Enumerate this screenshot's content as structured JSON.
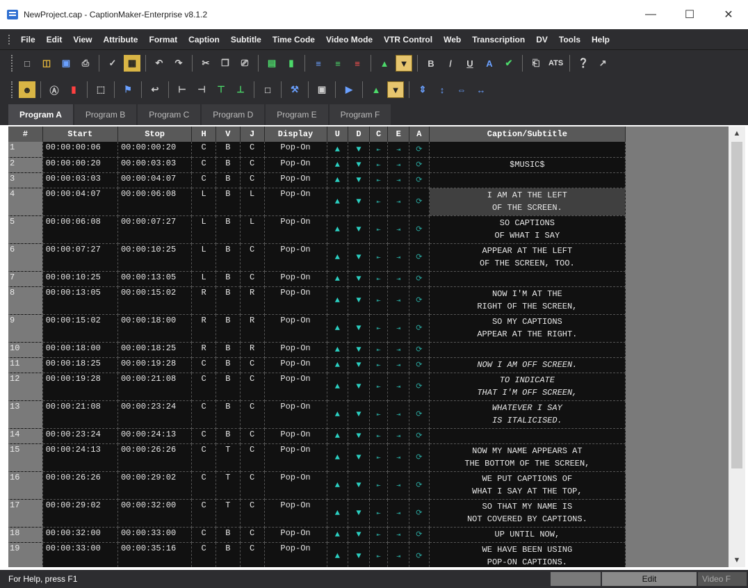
{
  "window": {
    "title": "NewProject.cap - CaptionMaker-Enterprise v8.1.2",
    "minimize": "—",
    "maximize": "☐",
    "close": "✕"
  },
  "menu": [
    "File",
    "Edit",
    "View",
    "Attribute",
    "Format",
    "Caption",
    "Subtitle",
    "Time Code",
    "Video Mode",
    "VTR Control",
    "Web",
    "Transcription",
    "DV",
    "Tools",
    "Help"
  ],
  "toolbar": {
    "bold": "B",
    "italic": "/",
    "underline": "U",
    "ats": "ATS"
  },
  "tabs": [
    "Program A",
    "Program B",
    "Program C",
    "Program D",
    "Program E",
    "Program F"
  ],
  "grid": {
    "headers": {
      "num": "#",
      "start": "Start",
      "stop": "Stop",
      "h": "H",
      "v": "V",
      "j": "J",
      "display": "Display",
      "u": "U",
      "d": "D",
      "c": "C",
      "e": "E",
      "a": "A",
      "caption": "Caption/Subtitle"
    },
    "rows": [
      {
        "n": "1",
        "start": "00:00:00:06",
        "stop": "00:00:00:20",
        "h": "C",
        "v": "B",
        "j": "C",
        "display": "Pop-On",
        "l1": "",
        "l2": ""
      },
      {
        "n": "2",
        "start": "00:00:00:20",
        "stop": "00:00:03:03",
        "h": "C",
        "v": "B",
        "j": "C",
        "display": "Pop-On",
        "l1": "$MUSIC$",
        "l2": ""
      },
      {
        "n": "3",
        "start": "00:00:03:03",
        "stop": "00:00:04:07",
        "h": "C",
        "v": "B",
        "j": "C",
        "display": "Pop-On",
        "l1": "",
        "l2": ""
      },
      {
        "n": "4",
        "start": "00:00:04:07",
        "stop": "00:00:06:08",
        "h": "L",
        "v": "B",
        "j": "L",
        "display": "Pop-On",
        "l1": "I AM AT THE LEFT",
        "l2": "OF THE SCREEN."
      },
      {
        "n": "5",
        "start": "00:00:06:08",
        "stop": "00:00:07:27",
        "h": "L",
        "v": "B",
        "j": "L",
        "display": "Pop-On",
        "l1": "SO CAPTIONS",
        "l2": "OF WHAT I SAY"
      },
      {
        "n": "6",
        "start": "00:00:07:27",
        "stop": "00:00:10:25",
        "h": "L",
        "v": "B",
        "j": "C",
        "display": "Pop-On",
        "l1": "APPEAR AT THE LEFT",
        "l2": "OF THE SCREEN, TOO."
      },
      {
        "n": "7",
        "start": "00:00:10:25",
        "stop": "00:00:13:05",
        "h": "L",
        "v": "B",
        "j": "C",
        "display": "Pop-On",
        "l1": "",
        "l2": ""
      },
      {
        "n": "8",
        "start": "00:00:13:05",
        "stop": "00:00:15:02",
        "h": "R",
        "v": "B",
        "j": "R",
        "display": "Pop-On",
        "l1": "NOW I'M AT THE",
        "l2": "RIGHT OF THE SCREEN,"
      },
      {
        "n": "9",
        "start": "00:00:15:02",
        "stop": "00:00:18:00",
        "h": "R",
        "v": "B",
        "j": "R",
        "display": "Pop-On",
        "l1": "SO MY CAPTIONS",
        "l2": "APPEAR AT THE RIGHT."
      },
      {
        "n": "10",
        "start": "00:00:18:00",
        "stop": "00:00:18:25",
        "h": "R",
        "v": "B",
        "j": "R",
        "display": "Pop-On",
        "l1": "",
        "l2": ""
      },
      {
        "n": "11",
        "start": "00:00:18:25",
        "stop": "00:00:19:28",
        "h": "C",
        "v": "B",
        "j": "C",
        "display": "Pop-On",
        "l1": "NOW I AM OFF SCREEN.",
        "l2": ""
      },
      {
        "n": "12",
        "start": "00:00:19:28",
        "stop": "00:00:21:08",
        "h": "C",
        "v": "B",
        "j": "C",
        "display": "Pop-On",
        "l1": "TO INDICATE",
        "l2": "THAT I'M OFF SCREEN,"
      },
      {
        "n": "13",
        "start": "00:00:21:08",
        "stop": "00:00:23:24",
        "h": "C",
        "v": "B",
        "j": "C",
        "display": "Pop-On",
        "l1": "WHATEVER I SAY",
        "l2": "IS ITALICISED."
      },
      {
        "n": "14",
        "start": "00:00:23:24",
        "stop": "00:00:24:13",
        "h": "C",
        "v": "B",
        "j": "C",
        "display": "Pop-On",
        "l1": "",
        "l2": ""
      },
      {
        "n": "15",
        "start": "00:00:24:13",
        "stop": "00:00:26:26",
        "h": "C",
        "v": "T",
        "j": "C",
        "display": "Pop-On",
        "l1": "NOW MY NAME APPEARS AT",
        "l2": "THE BOTTOM OF THE SCREEN,"
      },
      {
        "n": "16",
        "start": "00:00:26:26",
        "stop": "00:00:29:02",
        "h": "C",
        "v": "T",
        "j": "C",
        "display": "Pop-On",
        "l1": "WE PUT CAPTIONS OF",
        "l2": "WHAT I SAY AT THE TOP,"
      },
      {
        "n": "17",
        "start": "00:00:29:02",
        "stop": "00:00:32:00",
        "h": "C",
        "v": "T",
        "j": "C",
        "display": "Pop-On",
        "l1": "SO THAT MY NAME IS",
        "l2": "NOT COVERED BY CAPTIONS."
      },
      {
        "n": "18",
        "start": "00:00:32:00",
        "stop": "00:00:33:00",
        "h": "C",
        "v": "B",
        "j": "C",
        "display": "Pop-On",
        "l1": "UP UNTIL NOW,",
        "l2": ""
      },
      {
        "n": "19",
        "start": "00:00:33:00",
        "stop": "00:00:35:16",
        "h": "C",
        "v": "B",
        "j": "C",
        "display": "Pop-On",
        "l1": "WE HAVE BEEN USING",
        "l2": "POP-ON CAPTIONS."
      }
    ]
  },
  "status": {
    "help": "For Help, press F1",
    "mode": "Edit",
    "video": "Video F"
  }
}
